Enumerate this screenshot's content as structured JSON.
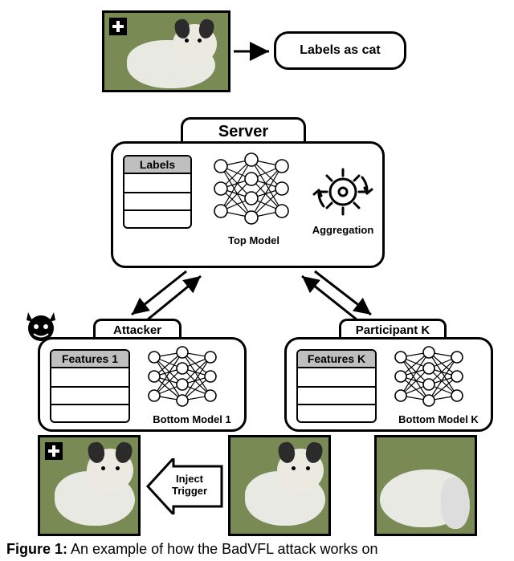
{
  "top": {
    "label": "Labels as cat"
  },
  "server": {
    "tab": "Server",
    "labels_header": "Labels",
    "top_model_caption": "Top Model",
    "aggregation_caption": "Aggregation"
  },
  "attacker": {
    "tab": "Attacker",
    "features_header": "Features 1",
    "bottom_model_caption": "Bottom Model 1"
  },
  "participant": {
    "tab": "Participant K",
    "features_header": "Features K",
    "bottom_model_caption": "Bottom Model K"
  },
  "inject_label_line1": "Inject",
  "inject_label_line2": "Trigger",
  "figure": {
    "number": "Figure 1:",
    "text": " An example of how the BadVFL attack works on"
  }
}
